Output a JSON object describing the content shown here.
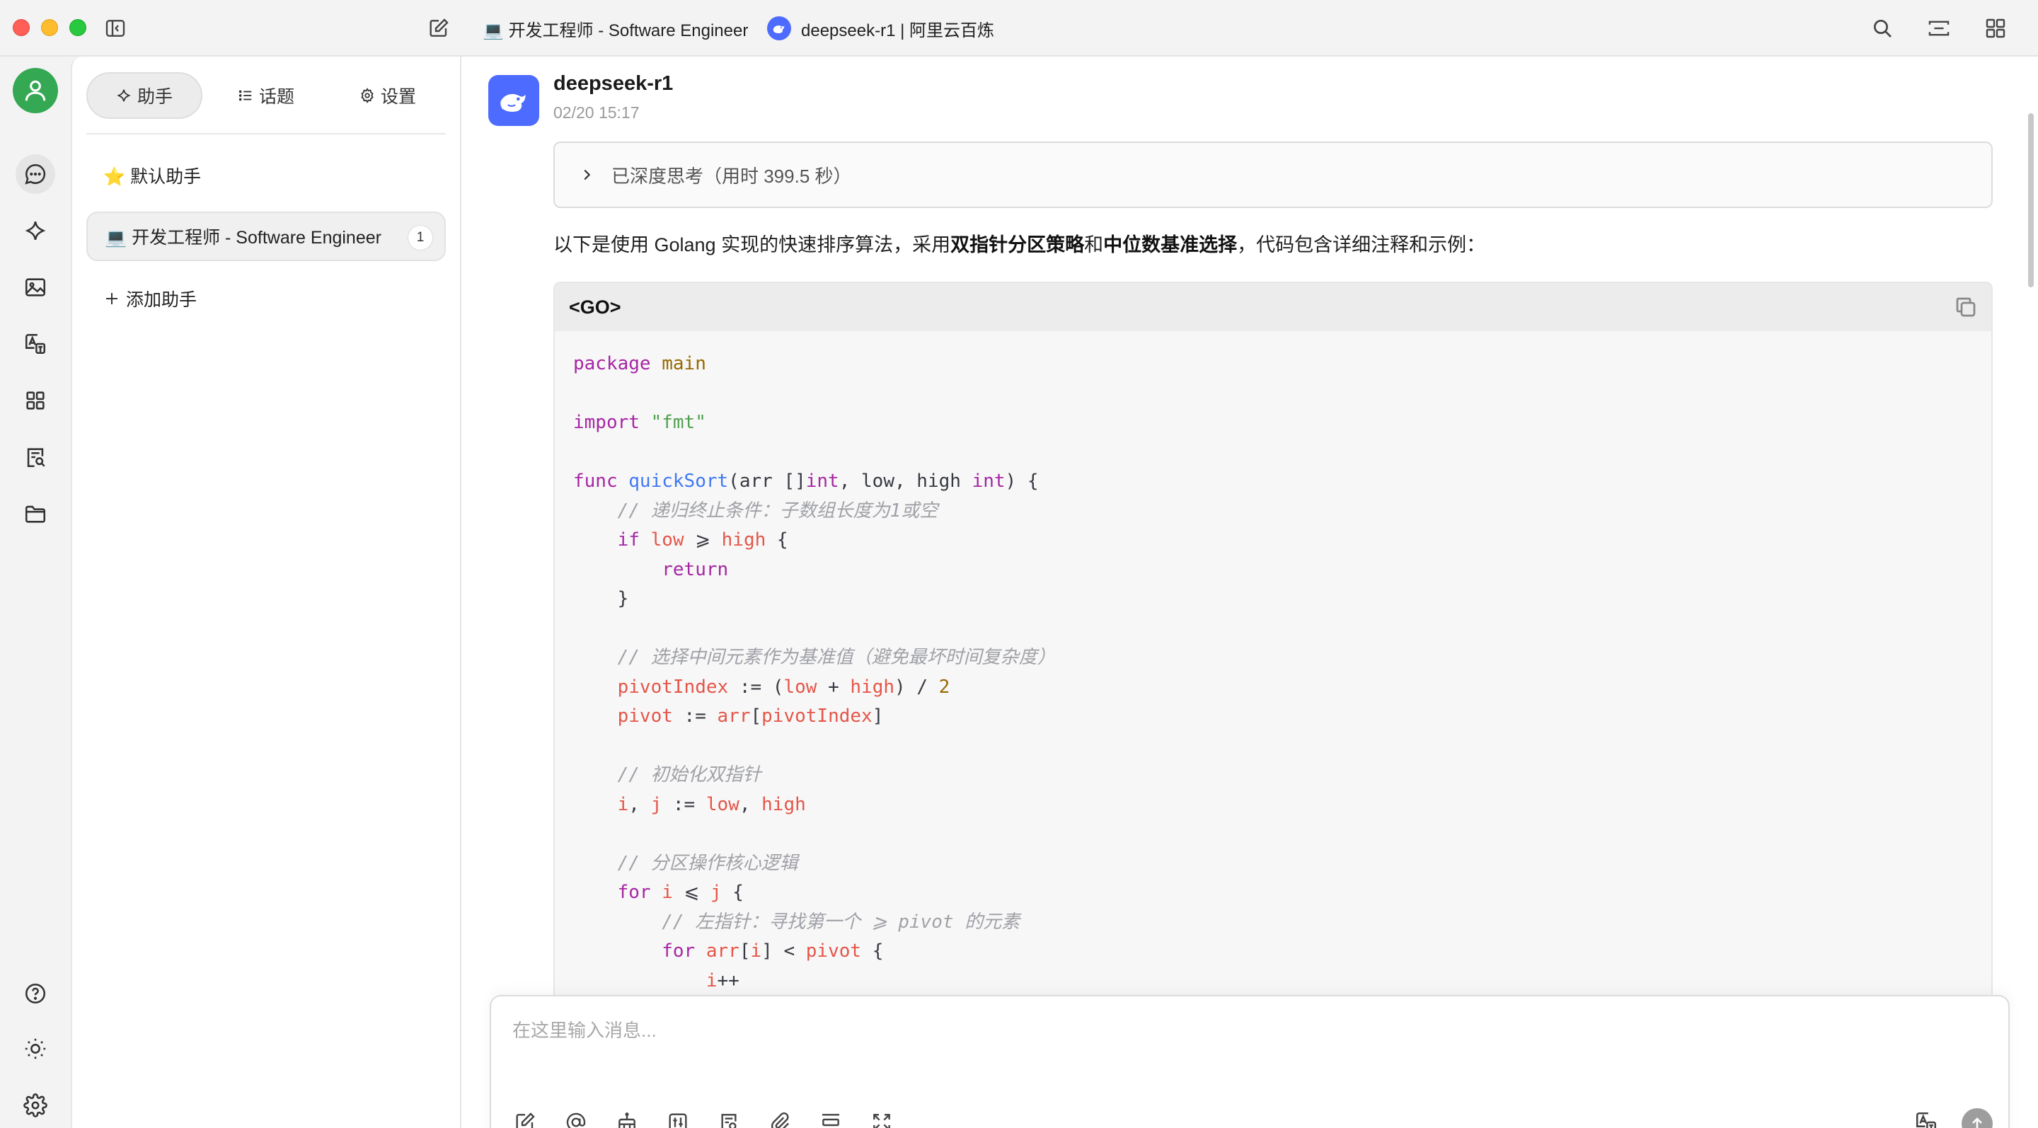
{
  "titlebar": {
    "assistant_title": "💻 开发工程师 - Software Engineer",
    "model_title": "deepseek-r1 | 阿里云百炼"
  },
  "panel": {
    "tabs": [
      {
        "label": "助手",
        "icon": "sparkle-icon"
      },
      {
        "label": "话题",
        "icon": "list-icon"
      },
      {
        "label": "设置",
        "icon": "gear-icon"
      }
    ],
    "assistants": [
      {
        "label": "⭐️ 默认助手"
      },
      {
        "label": "💻 开发工程师 - Software Engineer",
        "count": "1"
      }
    ],
    "add_label": "添加助手"
  },
  "message": {
    "model_name": "deepseek-r1",
    "timestamp": "02/20 15:17",
    "thinking_label": "已深度思考（用时 399.5 秒）",
    "intro_prefix": "以下是使用 Golang 实现的快速排序算法，采用",
    "intro_bold_1": "双指针分区策略",
    "intro_mid": "和",
    "intro_bold_2": "中位数基准选择",
    "intro_suffix": "，代码包含详细注释和示例：",
    "code_language": "<GO>"
  },
  "input": {
    "placeholder": "在这里输入消息..."
  },
  "colors": {
    "accent_blue": "#4d6bfe",
    "user_avatar": "#34a853",
    "code_keyword": "#a626a4",
    "code_string": "#50a14f",
    "code_function": "#4078f2",
    "code_variable": "#e45649",
    "code_comment": "#a0a1a7"
  }
}
